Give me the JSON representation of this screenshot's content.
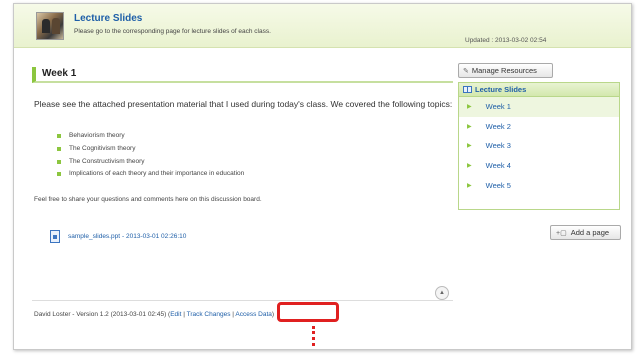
{
  "header": {
    "title": "Lecture Slides",
    "subtitle": "Please go to the corresponding page for lecture slides of each class.",
    "updated": "Updated : 2013-03-02 02:54"
  },
  "page": {
    "week_title": "Week 1",
    "intro": "Please see the attached presentation material that I used during today's class. We covered the following topics:",
    "topics": [
      "Behaviorism theory",
      "The Cognitivism theory",
      "The Constructivism theory",
      "Implications of each theory and their importance in education"
    ],
    "closing": "Feel free to share your questions and comments here on this discussion board.",
    "attachment": {
      "name": "sample_slides.ppt",
      "timestamp": "- 2013-03-01 02:26:10"
    }
  },
  "footer": {
    "meta": "David Loster - Version 1.2 (2013-03-01 02:45) (",
    "edit": "Edit",
    "sep1": " | ",
    "track": "Track Changes",
    "sep2": " | ",
    "access": "Access Data",
    "close": ")"
  },
  "sidebar": {
    "manage_label": "Manage Resources",
    "heading": "Lecture Slides",
    "items": [
      {
        "label": "Week 1"
      },
      {
        "label": "Week 2"
      },
      {
        "label": "Week 3"
      },
      {
        "label": "Week 4"
      },
      {
        "label": "Week 5"
      }
    ],
    "add_label": "Add a page"
  },
  "colors": {
    "accent": "#8cc63f",
    "link": "#1f5fa8",
    "highlight": "#e02020"
  }
}
